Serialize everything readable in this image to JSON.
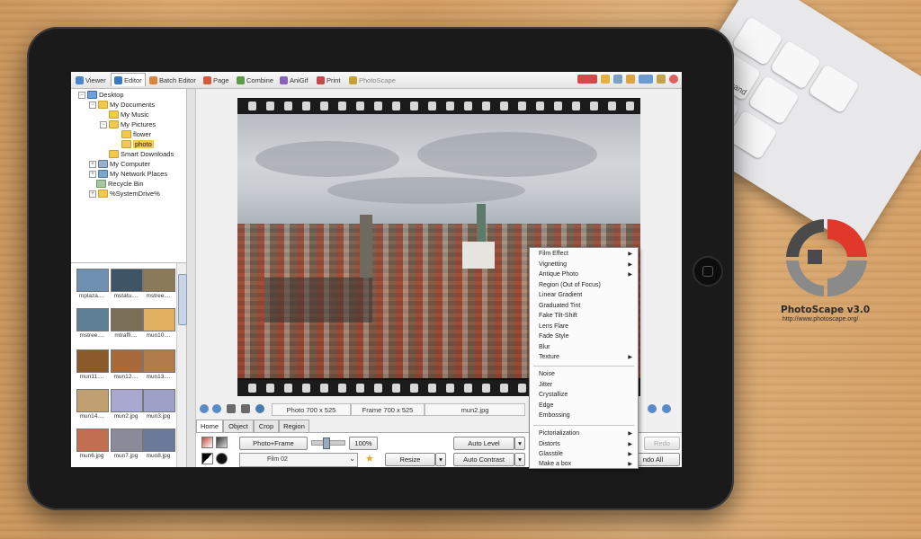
{
  "app": {
    "tabs": [
      {
        "label": "Viewer",
        "color": "#4a86c8"
      },
      {
        "label": "Editor",
        "color": "#3b78c2"
      },
      {
        "label": "Batch Editor",
        "color": "#d9843a"
      },
      {
        "label": "Page",
        "color": "#d55a3b"
      },
      {
        "label": "Combine",
        "color": "#5b9b4a"
      },
      {
        "label": "AniGif",
        "color": "#8a63b8"
      },
      {
        "label": "Print",
        "color": "#c24a4a"
      },
      {
        "label": "PhotoScape",
        "color": "#c8a03a"
      }
    ],
    "active_tab": "Editor",
    "topbar_icons": [
      "help-icon",
      "star-icon",
      "tools-icon",
      "folder-icon",
      "settings-icon",
      "info-icon"
    ]
  },
  "tree": {
    "nodes": [
      {
        "label": "Desktop"
      },
      {
        "label": "My Documents"
      },
      {
        "label": "My Music"
      },
      {
        "label": "My Pictures"
      },
      {
        "label": "flower"
      },
      {
        "label": "photo"
      },
      {
        "label": "Smart Downloads"
      },
      {
        "label": "My Computer"
      },
      {
        "label": "My Network Places"
      },
      {
        "label": "Recycle Bin"
      },
      {
        "label": "%SystemDrive%"
      }
    ],
    "selected": "photo"
  },
  "thumbnails": [
    {
      "label": "mplaza....",
      "color": "#6e8fb0"
    },
    {
      "label": "mstatu....",
      "color": "#3f5566"
    },
    {
      "label": "mstree....",
      "color": "#8a7a5a"
    },
    {
      "label": "mstree....",
      "color": "#5f7f96"
    },
    {
      "label": "mtraffi....",
      "color": "#7a6e56"
    },
    {
      "label": "mun10....",
      "color": "#e0b060"
    },
    {
      "label": "mun11....",
      "color": "#8a5a2a"
    },
    {
      "label": "mun12....",
      "color": "#a86a3a"
    },
    {
      "label": "mun13....",
      "color": "#b07a4a"
    },
    {
      "label": "mun14....",
      "color": "#c0a070"
    },
    {
      "label": "mun2.jpg",
      "color": "#a8a8d0"
    },
    {
      "label": "mun3.jpg",
      "color": "#9fa0c8"
    },
    {
      "label": "mun6.jpg",
      "color": "#c07050"
    },
    {
      "label": "mun7.jpg",
      "color": "#8a8a9a"
    },
    {
      "label": "mun8.jpg",
      "color": "#6a7a9a"
    }
  ],
  "status": {
    "photo_size": "Photo 700 x 525",
    "frame_size": "Frame 700 x 525",
    "filename": "mun2.jpg"
  },
  "bottom_tabs": [
    "Home",
    "Object",
    "Crop",
    "Region"
  ],
  "panel": {
    "photo_frame": "Photo+Frame",
    "zoom": "100%",
    "resize": "Resize",
    "auto_level": "Auto Level",
    "auto_contrast": "Auto Contrast",
    "redo": "Redo",
    "undo_all": "ndo All",
    "frame_select": "Film 02"
  },
  "filter_menu": {
    "group1": [
      {
        "label": "Film Effect",
        "submenu": true
      },
      {
        "label": "Vignetting",
        "submenu": true
      },
      {
        "label": "Antique Photo",
        "submenu": true
      },
      {
        "label": "Region (Out of Focus)",
        "submenu": false
      },
      {
        "label": "Linear Gradient",
        "submenu": false
      },
      {
        "label": "Graduated Tint",
        "submenu": false
      },
      {
        "label": "Fake Tilt-Shift",
        "submenu": false
      },
      {
        "label": "Lens Flare",
        "submenu": false
      },
      {
        "label": "Fade Style",
        "submenu": false
      },
      {
        "label": "Blur",
        "submenu": false
      },
      {
        "label": "Texture",
        "submenu": true
      }
    ],
    "group2": [
      {
        "label": "Noise",
        "submenu": false
      },
      {
        "label": "Jitter",
        "submenu": false
      },
      {
        "label": "Crystallize",
        "submenu": false
      },
      {
        "label": "Edge",
        "submenu": false
      },
      {
        "label": "Embossing",
        "submenu": false
      }
    ],
    "group3": [
      {
        "label": "Pictorialization",
        "submenu": true
      },
      {
        "label": "Distorts",
        "submenu": true
      },
      {
        "label": "Glasstile",
        "submenu": true
      },
      {
        "label": "Make a box",
        "submenu": true
      }
    ]
  },
  "branding": {
    "name": "PhotoScape v3.0",
    "url": "http://www.photoscape.org/",
    "colors": {
      "accent": "#e0392b",
      "gray": "#8a8a8a",
      "dark": "#4a4a4a"
    }
  },
  "keyboard": {
    "keys": [
      "command",
      "option"
    ]
  }
}
